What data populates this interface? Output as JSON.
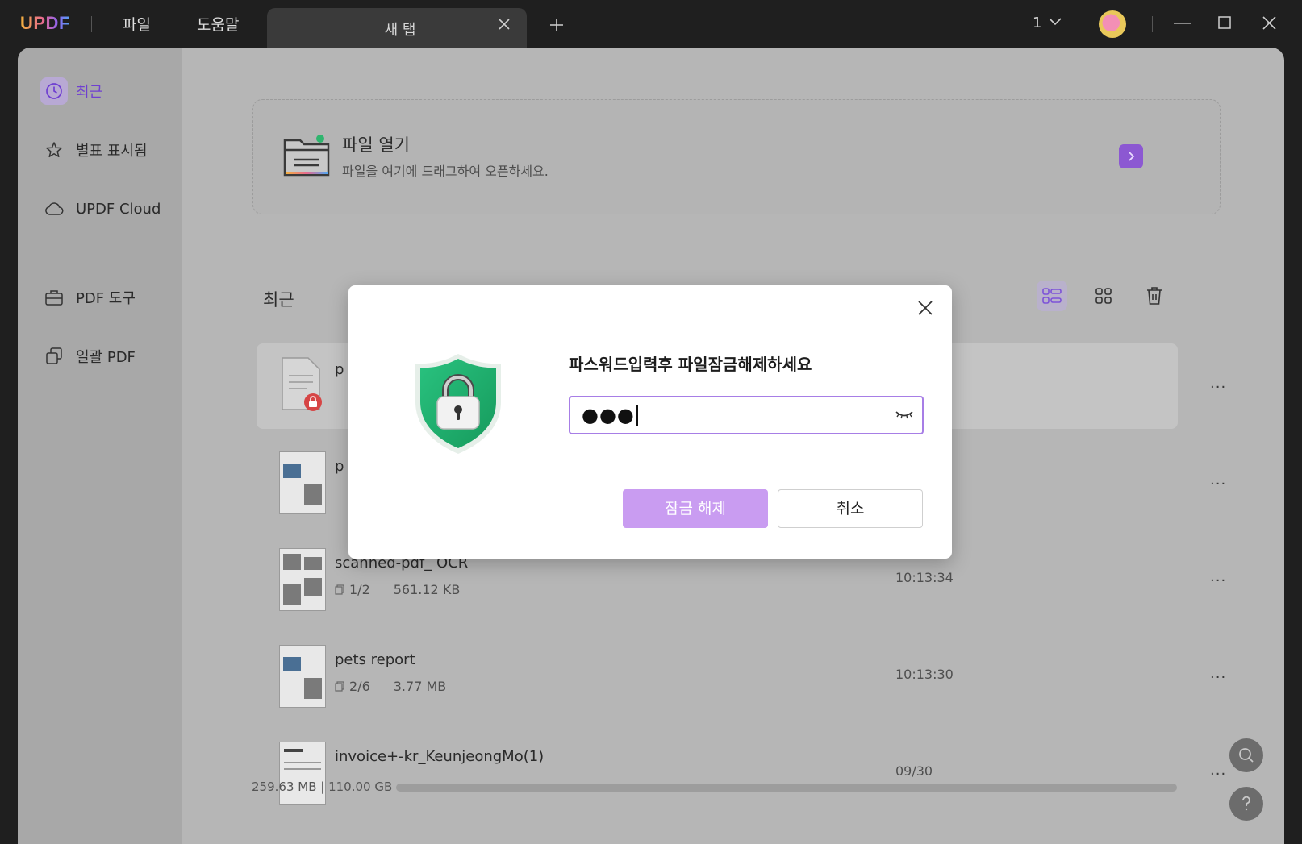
{
  "titlebar": {
    "logo": "UPDF",
    "menu_file": "파일",
    "menu_help": "도움말",
    "tab_label": "새 탭",
    "page_count": "1"
  },
  "sidebar": {
    "items": [
      {
        "label": "최근",
        "icon": "clock-icon",
        "active": true
      },
      {
        "label": "별표 표시됨",
        "icon": "star-icon"
      },
      {
        "label": "UPDF Cloud",
        "icon": "cloud-icon"
      },
      {
        "label": "PDF 도구",
        "icon": "toolbox-icon"
      },
      {
        "label": "일괄 PDF",
        "icon": "batch-icon"
      }
    ]
  },
  "open_file": {
    "title": "파일 열기",
    "subtitle": "파일을 여기에 드래그하여 오픈하세요."
  },
  "recent": {
    "heading": "최근",
    "files": [
      {
        "name": "p",
        "pages": "",
        "size": "",
        "time": "",
        "locked": true
      },
      {
        "name": "p",
        "pages": "",
        "size": "",
        "time": ""
      },
      {
        "name": "scanned-pdf_ OCR",
        "pages": "1/2",
        "size": "561.12 KB",
        "time": "10:13:34"
      },
      {
        "name": "pets report",
        "pages": "2/6",
        "size": "3.77 MB",
        "time": "10:13:30"
      },
      {
        "name": "invoice+-kr_KeunjeongMo(1)",
        "pages": "",
        "size": "",
        "time": "09/30"
      }
    ],
    "more_label": "···"
  },
  "storage": {
    "text": "259.63 MB | 110.00 GB"
  },
  "dialog": {
    "title": "파스워드입력후 파일잠금해제하세요",
    "password_mask": "●●●",
    "unlock_label": "잠금 해제",
    "cancel_label": "취소"
  },
  "colors": {
    "accent": "#8c58d2",
    "unlock_button": "#c99cf1",
    "shield_green": "#22b573"
  }
}
